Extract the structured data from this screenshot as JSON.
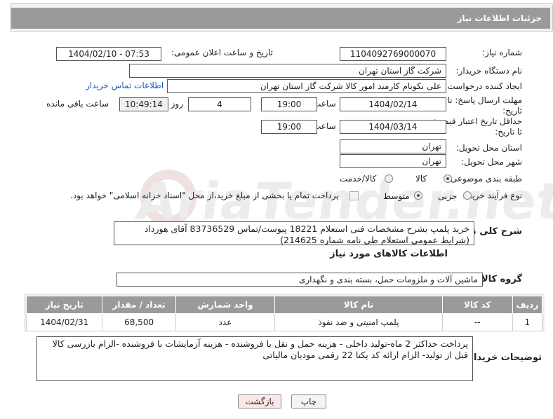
{
  "header": {
    "title": "جزئیات اطلاعات نیاز"
  },
  "watermark": {
    "text": "AriaTender.net"
  },
  "form": {
    "need_number": {
      "label": "شماره نیاز:",
      "value": "1104092769000070"
    },
    "announce_date": {
      "label": "تاریخ و ساعت اعلان عمومی:",
      "value": "1404/02/10 - 07:53"
    },
    "buyer_org": {
      "label": "نام دستگاه خریدار:",
      "value": "شرکت گاز استان تهران"
    },
    "requester": {
      "label": "ایجاد کننده درخواست:",
      "value": "علی نکونام کارمند امور کالا شرکت گاز استان تهران",
      "contact_link": "اطلاعات تماس خریدار"
    },
    "reply_deadline": {
      "label_line1": "مهلت ارسال پاسخ: تا",
      "label_line2": "تاریخ:",
      "date": "1404/02/14",
      "time_label": "ساعت",
      "time": "19:00",
      "days": "4",
      "days_label": "روز و",
      "remaining": "10:49:14",
      "remaining_label": "ساعت باقی مانده"
    },
    "price_validity": {
      "label_line1": "حداقل تاریخ اعتبار قیمت:",
      "label_line2": "تا تاریخ:",
      "date": "1404/03/14",
      "time_label": "ساعت",
      "time": "19:00"
    },
    "delivery_province": {
      "label": "استان محل تحویل:",
      "value": "تهران"
    },
    "delivery_city": {
      "label": "شهر محل تحویل:",
      "value": "تهران"
    },
    "category": {
      "label": "طبقه بندی موضوعی:",
      "options": [
        "کالا",
        "کالا/خدمت"
      ],
      "selected": "کالا"
    },
    "process_type": {
      "label": "نوع فرآیند خرید :",
      "options": [
        "جزیی",
        "متوسط"
      ],
      "selected": "متوسط",
      "payment_note": "پرداخت تمام یا بخشی از مبلغ خرید،از محل \"اسناد خزانه اسلامی\" خواهد بود."
    }
  },
  "overview": {
    "label": "شرح کلی نیاز:",
    "text": "خرید پلمپ بشرح مشخصات فنی استعلام 18221 پیوست/تماس 83736529 آقای هورداد (شرایط عمومی استعلام طی نامه شماره 214625)"
  },
  "goods_info": {
    "title": "اطلاعات کالاهای مورد نیاز",
    "group_label": "گروه کالا:",
    "group_value": "ماشین آلات و ملزومات حمل، بسته بندی و نگهداری",
    "table": {
      "headers": [
        "ردیف",
        "کد کالا",
        "نام کالا",
        "واحد شمارش",
        "تعداد / مقدار",
        "تاریخ نیاز"
      ],
      "rows": [
        [
          "1",
          "--",
          "پلمپ امنیتی و ضد نفوذ",
          "عدد",
          "68,500",
          "1404/02/31"
        ]
      ]
    }
  },
  "buyer_notes": {
    "label": "توضیحات خریدار:",
    "text": "پرداخت حداکثر 2 ماه-تولید داخلی - هزینه حمل و نقل با فروشنده - هزینه آزمایشات با فروشنده -الزام بازرسی کالا قبل از تولید- الزام ارائه کد یکتا 22 رقمی مودیان مالیاتی"
  },
  "buttons": {
    "print": "چاپ",
    "back": "بازگشت"
  },
  "colors": {
    "header_bg": "#9a9a9a",
    "link": "#1a5bb5",
    "back_button_bg": "#fde8e8"
  }
}
